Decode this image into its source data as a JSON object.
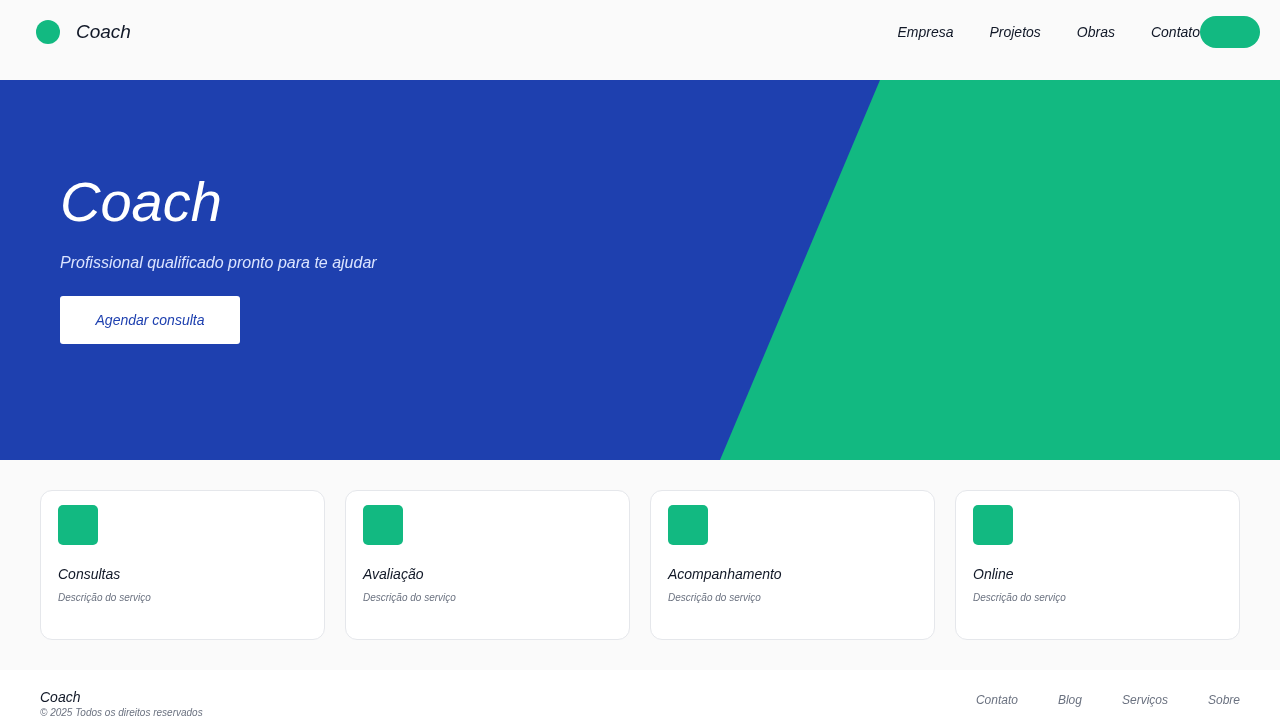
{
  "header": {
    "brand": "Coach",
    "nav": [
      "Empresa",
      "Projetos",
      "Obras",
      "Contato"
    ]
  },
  "hero": {
    "title": "Coach",
    "subtitle": "Profissional qualificado pronto para te ajudar",
    "button": "Agendar consulta"
  },
  "services": [
    {
      "title": "Consultas",
      "description": "Descrição do serviço"
    },
    {
      "title": "Avaliação",
      "description": "Descrição do serviço"
    },
    {
      "title": "Acompanhamento",
      "description": "Descrição do serviço"
    },
    {
      "title": "Online",
      "description": "Descrição do serviço"
    }
  ],
  "footer": {
    "brand": "Coach",
    "copyright": "© 2025 Todos os direitos reservados",
    "links": [
      "Contato",
      "Blog",
      "Serviços",
      "Sobre"
    ]
  }
}
